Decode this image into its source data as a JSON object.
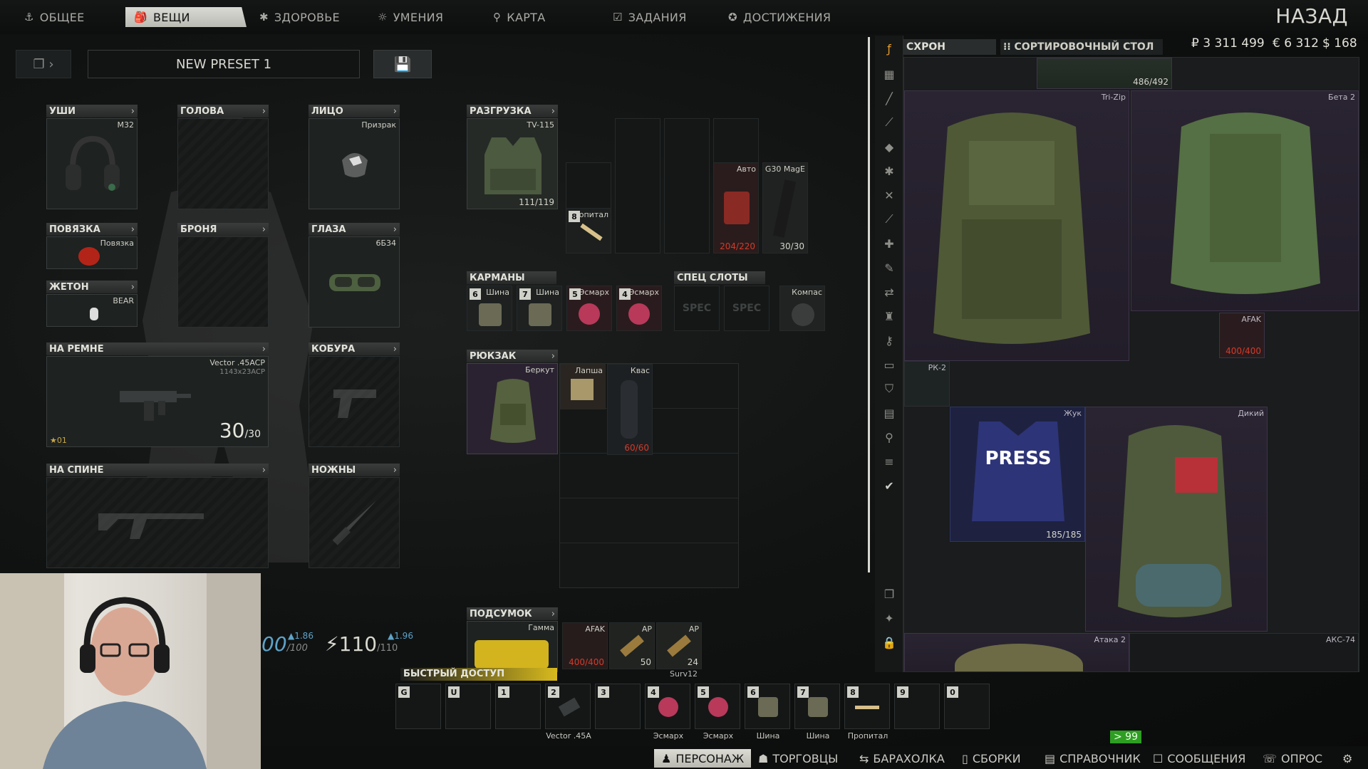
{
  "tabs": [
    {
      "label": "ОБЩЕЕ",
      "icon": "anchor-icon"
    },
    {
      "label": "ВЕЩИ",
      "icon": "backpack-icon"
    },
    {
      "label": "ЗДОРОВЬЕ",
      "icon": "health-icon"
    },
    {
      "label": "УМЕНИЯ",
      "icon": "skills-icon"
    },
    {
      "label": "КАРТА",
      "icon": "map-pin-icon"
    },
    {
      "label": "ЗАДАНИЯ",
      "icon": "tasks-icon"
    },
    {
      "label": "ДОСТИЖЕНИЯ",
      "icon": "achievement-icon"
    }
  ],
  "back_label": "НАЗАД",
  "preset": {
    "name": "NEW PRESET 1"
  },
  "slots": {
    "ears": {
      "label": "УШИ",
      "item": "M32"
    },
    "head": {
      "label": "ГОЛОВА"
    },
    "face": {
      "label": "ЛИЦО",
      "item": "Призрак"
    },
    "armband": {
      "label": "ПОВЯЗКА",
      "item": "Повязка"
    },
    "armor": {
      "label": "БРОНЯ"
    },
    "eyes": {
      "label": "ГЛАЗА",
      "item": "6Б34"
    },
    "tag": {
      "label": "ЖЕТОН",
      "item": "BEAR"
    },
    "on_sling": {
      "label": "НА РЕМНЕ",
      "item": "Vector .45ACP",
      "sub": "1143x23ACP",
      "ammo": "30",
      "ammo_max": "/30",
      "level": "01"
    },
    "holster": {
      "label": "КОБУРА"
    },
    "on_back": {
      "label": "НА СПИНЕ"
    },
    "sheath": {
      "label": "НОЖНЫ"
    },
    "rig": {
      "label": "РАЗГРУЗКА",
      "item": "TV-115",
      "durability": "111/119"
    },
    "pockets": {
      "label": "КАРМАНЫ"
    },
    "special": {
      "label": "СПЕЦ СЛОТЫ",
      "spec1": "SPEC",
      "spec2": "SPEC",
      "compass": "Компас"
    },
    "backpack": {
      "label": "РЮКЗАК",
      "item": "Беркут"
    },
    "pouch": {
      "label": "ПОДСУМОК",
      "item": "Гамма"
    }
  },
  "rig_items": {
    "propital": {
      "tag": "8",
      "name": "опитал"
    },
    "auto": {
      "name": "Авто",
      "count": "204/220"
    },
    "mag": {
      "name": "G30 MagE",
      "count": "30/30"
    }
  },
  "pocket_items": [
    {
      "tag": "6",
      "name": "Шина"
    },
    {
      "tag": "7",
      "name": "Шина"
    },
    {
      "tag": "5",
      "name": "Эсмарх"
    },
    {
      "tag": "4",
      "name": "Эсмарх"
    }
  ],
  "backpack_items": {
    "lapsha": {
      "name": "Лапша"
    },
    "kvas": {
      "name": "Квас",
      "count": "60/60"
    }
  },
  "pouch_items": {
    "afak": {
      "name": "AFAK",
      "count": "400/400"
    },
    "ap1": {
      "name": "AP",
      "count": "50"
    },
    "ap2": {
      "name": "AP",
      "count": "24"
    },
    "surv": "Surv12"
  },
  "stats": {
    "weight": "00",
    "weight_max": "/100",
    "weight_delta": "▲1.86",
    "energy": "110",
    "energy_max": "/110",
    "energy_delta": "▲1.96"
  },
  "quick_access": {
    "label": "БЫСТРЫЙ ДОСТУП",
    "slots": [
      {
        "key": "G",
        "label": ""
      },
      {
        "key": "U",
        "label": ""
      },
      {
        "key": "1",
        "label": ""
      },
      {
        "key": "2",
        "label": "Vector .45A"
      },
      {
        "key": "3",
        "label": ""
      },
      {
        "key": "4",
        "label": "Эсмарх"
      },
      {
        "key": "5",
        "label": "Эсмарх"
      },
      {
        "key": "6",
        "label": "Шина"
      },
      {
        "key": "7",
        "label": "Шина"
      },
      {
        "key": "8",
        "label": "Пропитал"
      },
      {
        "key": "9",
        "label": ""
      },
      {
        "key": "0",
        "label": ""
      }
    ]
  },
  "stash": {
    "tab1": "СХРОН",
    "tab2": "СОРТИРОВОЧНЫЙ СТОЛ",
    "rub": "₽ 3 311 499",
    "eur": "€ 6 312",
    "usd": "$ 168",
    "items": {
      "top_count": "486/492",
      "trizip": "Tri-Zip",
      "beta2": "Бета 2",
      "afak": "AFAK",
      "afak_count": "400/400",
      "rk2": "РК-2",
      "zhuk": "Жук",
      "zhuk_count": "185/185",
      "dikiy": "Дикий",
      "ataka2": "Атака 2",
      "aks74": "АКС-74"
    }
  },
  "fps": "> 99",
  "bottom_nav": [
    {
      "label": "ПЕРСОНАЖ",
      "icon": "character-icon"
    },
    {
      "label": "ТОРГОВЦЫ",
      "icon": "traders-icon"
    },
    {
      "label": "БАРАХОЛКА",
      "icon": "flea-market-icon"
    },
    {
      "label": "СБОРКИ",
      "icon": "builds-icon"
    },
    {
      "label": "СПРАВОЧНИК",
      "icon": "handbook-icon"
    },
    {
      "label": "СООБЩЕНИЯ",
      "icon": "messages-icon"
    },
    {
      "label": "ОПРОС",
      "icon": "survey-icon"
    }
  ]
}
